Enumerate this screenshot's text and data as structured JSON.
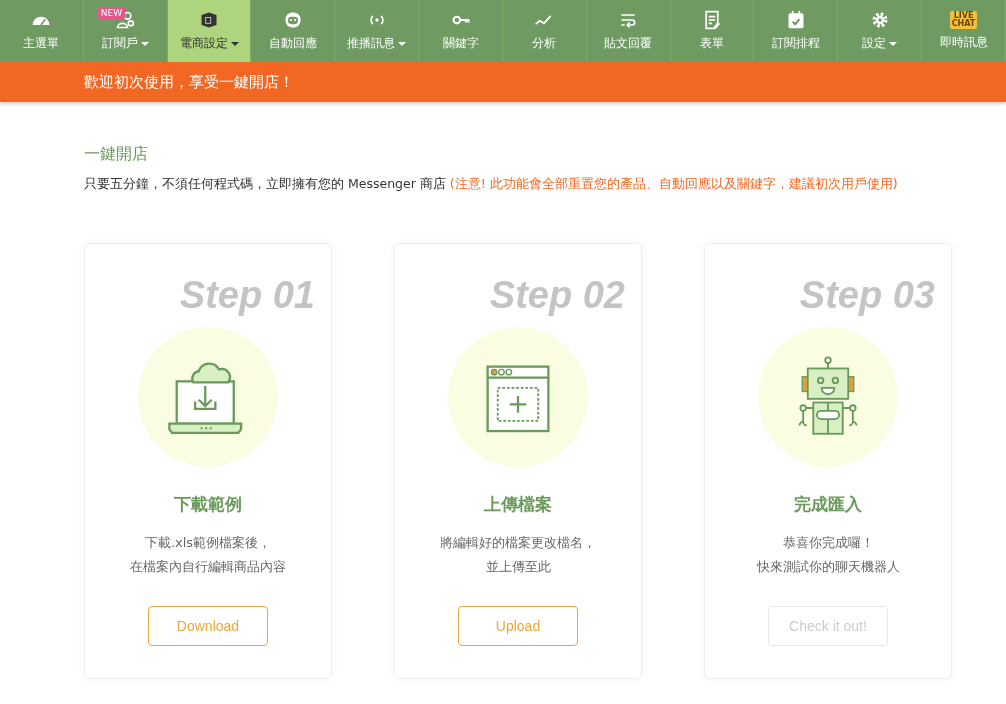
{
  "nav": [
    {
      "label": "主選單",
      "kind": "gauge",
      "selected": false,
      "dropdown": false
    },
    {
      "label": "訂閱戶",
      "kind": "users",
      "selected": false,
      "dropdown": true,
      "badge": "NEW"
    },
    {
      "label": "電商設定",
      "kind": "box",
      "selected": true,
      "dropdown": true
    },
    {
      "label": "自動回應",
      "kind": "bot",
      "selected": false,
      "dropdown": false
    },
    {
      "label": "推播訊息",
      "kind": "broadcast",
      "selected": false,
      "dropdown": true
    },
    {
      "label": "關鍵字",
      "kind": "key",
      "selected": false,
      "dropdown": false
    },
    {
      "label": "分析",
      "kind": "chart",
      "selected": false,
      "dropdown": false
    },
    {
      "label": "貼文回覆",
      "kind": "wrap",
      "selected": false,
      "dropdown": false
    },
    {
      "label": "表單",
      "kind": "form",
      "selected": false,
      "dropdown": false
    },
    {
      "label": "訂閱排程",
      "kind": "calendar",
      "selected": false,
      "dropdown": false
    },
    {
      "label": "設定",
      "kind": "gear",
      "selected": false,
      "dropdown": true
    },
    {
      "label": "即時訊息",
      "kind": "livechat",
      "selected": false,
      "dropdown": false,
      "icon_text": [
        "LIVE",
        "CHAT"
      ]
    }
  ],
  "banner": "歡迎初次使用，享受一鍵開店！",
  "section": {
    "title": "一鍵開店",
    "intro": "只要五分鐘，不須任何程式碼，立即擁有您的 Messenger 商店",
    "warning": "(注意! 此功能會全部重置您的產品、自動回應以及關鍵字，建議初次用戶使用)"
  },
  "steps": [
    {
      "step": "Step 01",
      "kind": "download",
      "title": "下載範例",
      "lines": [
        "下載.xls範例檔案後，",
        "在檔案內自行編輯商品內容"
      ],
      "button": "Download",
      "disabled": false
    },
    {
      "step": "Step 02",
      "kind": "upload",
      "title": "上傳檔案",
      "lines": [
        "將編輯好的檔案更改檔名，",
        "並上傳至此"
      ],
      "button": "Upload",
      "disabled": false
    },
    {
      "step": "Step 03",
      "kind": "robot",
      "title": "完成匯入",
      "lines": [
        "恭喜你完成囉！",
        "快來測試你的聊天機器人"
      ],
      "button": "Check it out!",
      "disabled": true
    }
  ]
}
